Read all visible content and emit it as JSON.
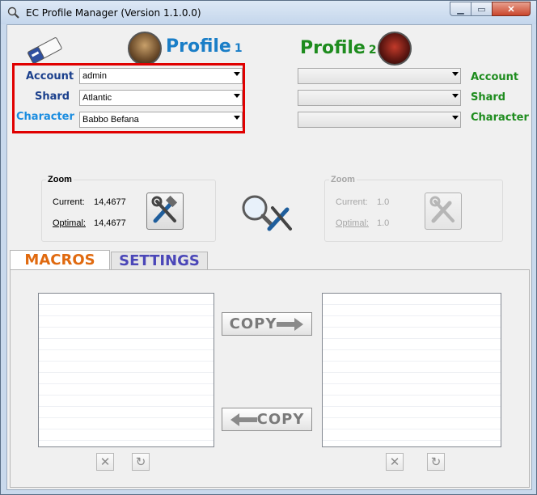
{
  "window": {
    "title": "EC Profile Manager (Version 1.1.0.0)"
  },
  "profile1": {
    "title": "Profile",
    "number": "1",
    "labels": {
      "account": "Account",
      "shard": "Shard",
      "character": "Character"
    },
    "values": {
      "account": "admin",
      "shard": "Atlantic",
      "character": "Babbo Befana"
    }
  },
  "profile2": {
    "title": "Profile",
    "number": "2",
    "labels": {
      "account": "Account",
      "shard": "Shard",
      "character": "Character"
    },
    "values": {
      "account": "",
      "shard": "",
      "character": ""
    }
  },
  "zoom1": {
    "legend": "Zoom",
    "current_label": "Current:",
    "current_value": "14,4677",
    "optimal_label": "Optimal:",
    "optimal_value": "14,4677"
  },
  "zoom2": {
    "legend": "Zoom",
    "current_label": "Current:",
    "current_value": "1.0",
    "optimal_label": "Optimal:",
    "optimal_value": "1.0"
  },
  "tabs": {
    "macros": "MACROS",
    "settings": "SETTINGS"
  },
  "copy": {
    "right_label": "COPY",
    "left_label": "COPY"
  },
  "colors": {
    "profile1": "#1a7ec7",
    "profile2": "#1e8c1e",
    "highlight": "#e00000",
    "macros_tab": "#e06a10",
    "settings_tab": "#4a46b8"
  },
  "icons": [
    "app-icon",
    "eraser-icon",
    "avatar-icon",
    "tools-icon",
    "magnifier-tools-icon",
    "arrow-right-icon",
    "arrow-left-icon",
    "close-x-icon",
    "refresh-icon"
  ]
}
